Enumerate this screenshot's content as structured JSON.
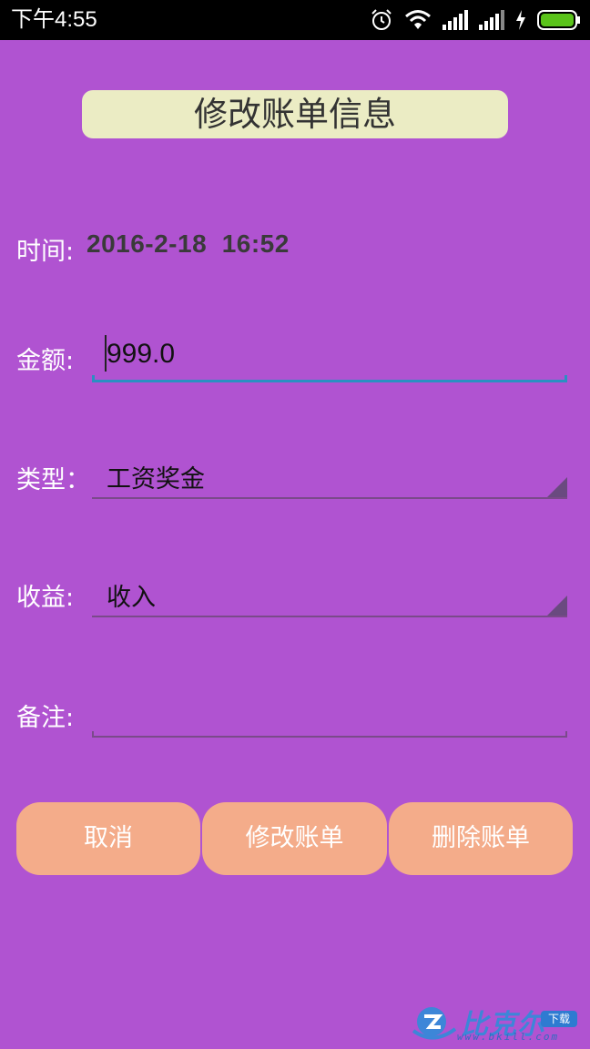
{
  "status_bar": {
    "time": "下午4:55",
    "icons": [
      "alarm-icon",
      "wifi-icon",
      "signal-icon",
      "signal-icon",
      "charging-icon",
      "battery-icon"
    ],
    "battery_color": "#5ac31a"
  },
  "page": {
    "title": "修改账单信息"
  },
  "form": {
    "time_label": "时间:",
    "time_value": "2016-2-18  16:52",
    "amount_label": "金额:",
    "amount_value": "999.0",
    "type_label": "类型：",
    "type_value": "工资奖金",
    "income_label": "收益:",
    "income_value": "收入",
    "note_label": "备注:",
    "note_value": ""
  },
  "buttons": {
    "cancel": "取消",
    "modify": "修改账单",
    "delete": "删除账单"
  },
  "watermark": {
    "brand": "比克尔",
    "badge": "下载",
    "url": "www.bkill.com"
  },
  "colors": {
    "background": "#b053d1",
    "title_box": "#ebecc4",
    "button": "#f4ac8a",
    "focus_underline": "#2a8fc2"
  }
}
